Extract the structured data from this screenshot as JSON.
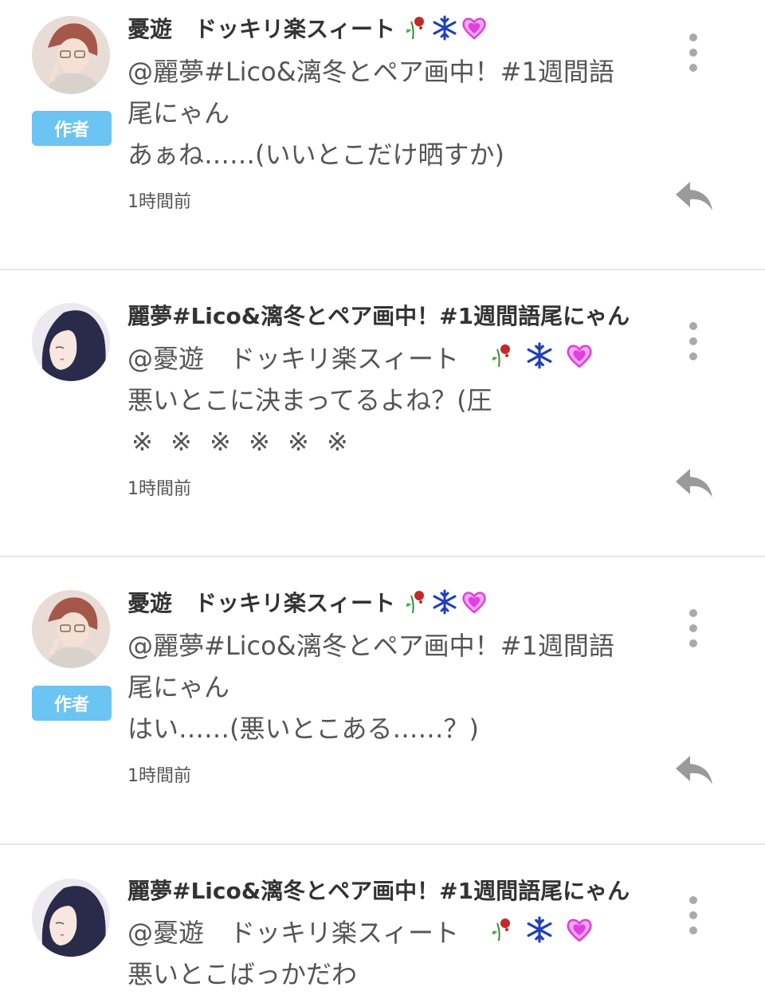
{
  "comments": [
    {
      "name": "憂遊　ドッキリ楽スィート",
      "badge": "作者",
      "lines": [
        "@麗夢#Lico&漓冬とペア画中！#1週間語",
        "尾にゃん",
        "あぁね……(いいとこだけ晒すか)"
      ],
      "time": "1時間前",
      "avatar": "avatar-author"
    },
    {
      "name": "麗夢#Lico&漓冬とペア画中！#1週間語尾にゃん",
      "badge": "",
      "lines": [
        "@憂遊　ドッキリ楽スィート",
        "悪いとこに決まってるよね？(圧",
        "※ ※ ※ ※ ※ ※"
      ],
      "time": "1時間前",
      "avatar": "avatar-reimu"
    },
    {
      "name": "憂遊　ドッキリ楽スィート",
      "badge": "作者",
      "lines": [
        "@麗夢#Lico&漓冬とペア画中！#1週間語",
        "尾にゃん",
        "はい……(悪いとこある……？)"
      ],
      "time": "1時間前",
      "avatar": "avatar-author"
    },
    {
      "name": "麗夢#Lico&漓冬とペア画中！#1週間語尾にゃん",
      "badge": "",
      "lines": [
        "@憂遊　ドッキリ楽スィート",
        "悪いとこばっかだわ"
      ],
      "time": "",
      "avatar": "avatar-reimu"
    }
  ],
  "emoji_icons": [
    "wilted-rose-icon",
    "snowflake-icon",
    "sparkling-heart-icon"
  ],
  "colors": {
    "badge": "#6cc4f2",
    "text": "#555555",
    "name": "#333333",
    "icon_gray": "#aaaaaa",
    "snowflake": "#1f3fbf",
    "heart": "#e040e0"
  }
}
